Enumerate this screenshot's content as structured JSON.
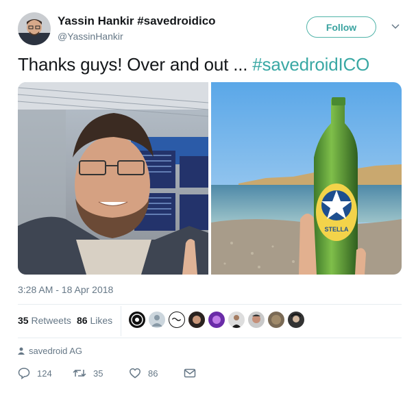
{
  "tweet": {
    "author_name": "Yassin Hankir #savedroidico",
    "author_handle": "@YassinHankir",
    "follow_label": "Follow",
    "text_main": "Thanks guys! Over and out ... ",
    "text_hashtag": "#savedroidICO",
    "timestamp": "3:28 AM - 18 Apr 2018",
    "retweets_count": "35",
    "retweets_label": "Retweets",
    "likes_count": "86",
    "likes_label": "Likes",
    "source": "savedroid AG"
  },
  "actions": {
    "reply_count": "124",
    "retweet_count": "35",
    "like_count": "86"
  },
  "media": {
    "photo1_icon": "selfie-airport",
    "photo2_icon": "beer-bottle-beach",
    "bottle_label": "STELLA"
  },
  "colors": {
    "accent": "#3aa8a4",
    "muted": "#657786"
  }
}
